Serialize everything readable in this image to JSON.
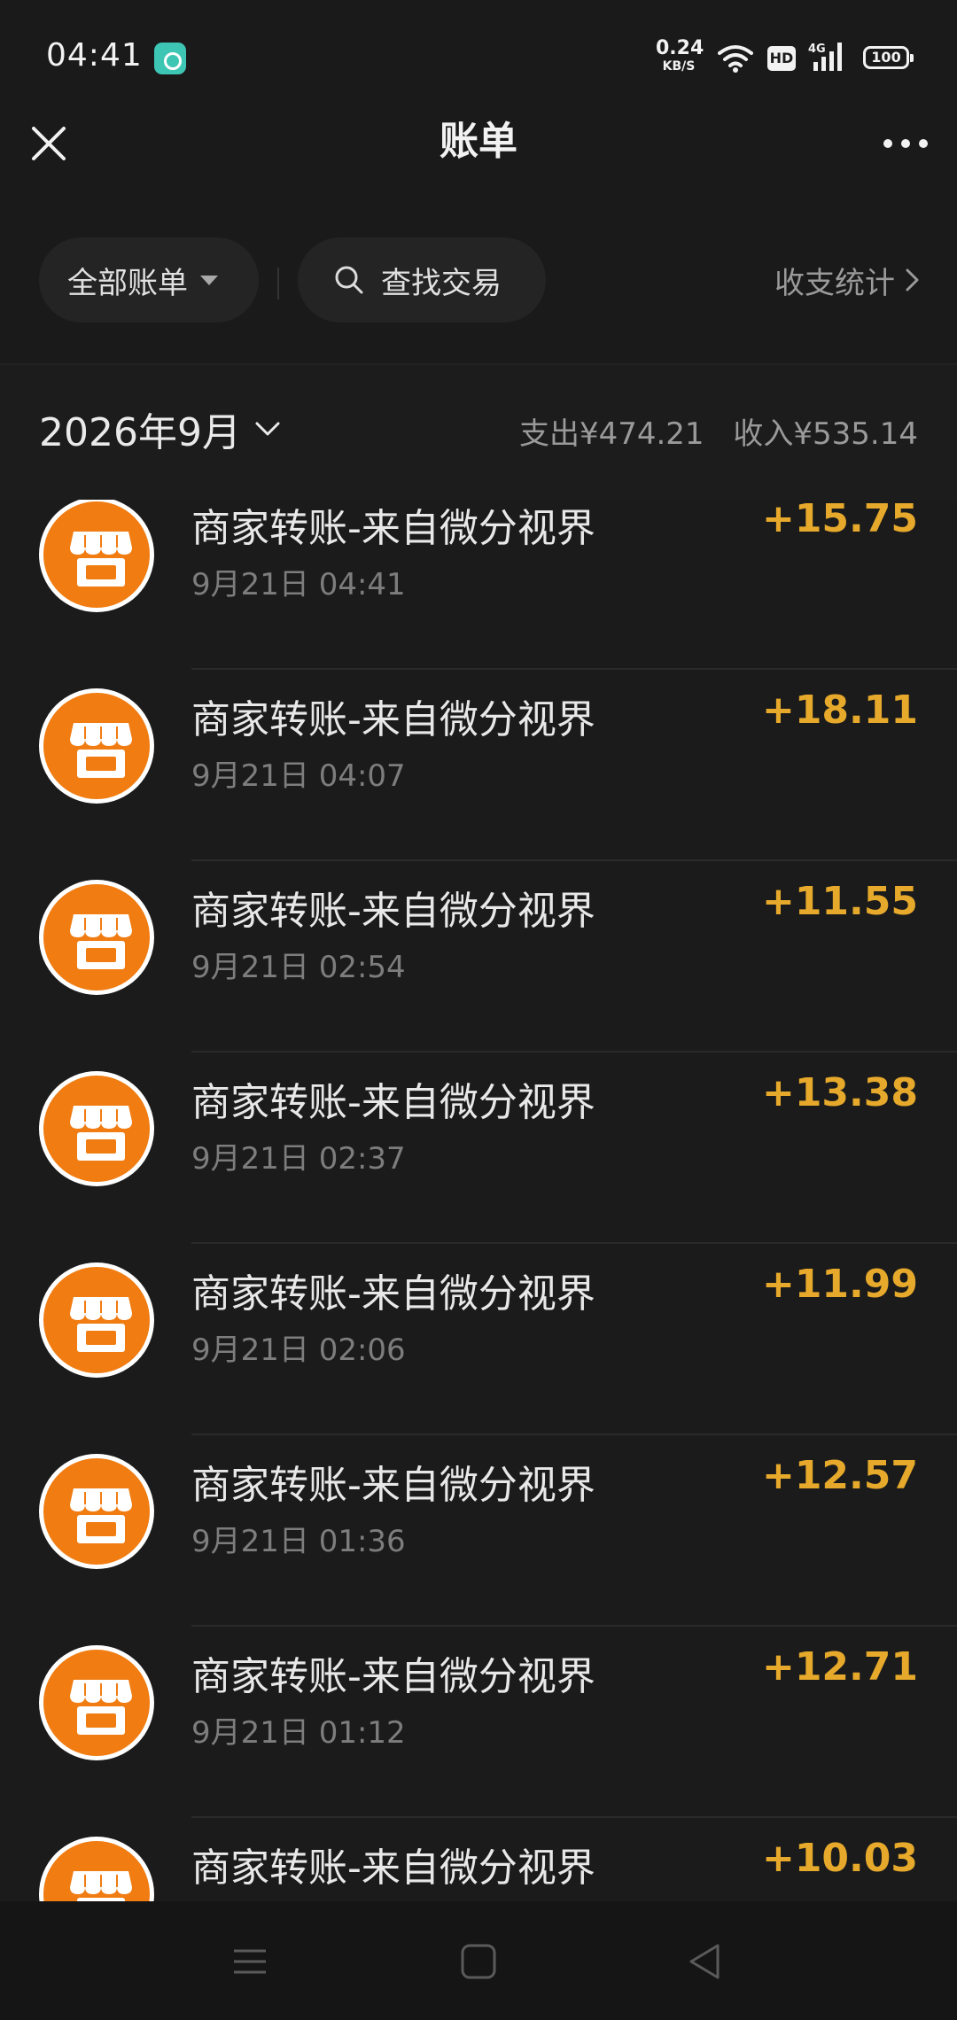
{
  "status_bar": {
    "time": "04:41",
    "net_speed_value": "0.24",
    "net_speed_unit": "KB/S",
    "hd_label": "HD",
    "signal_label": "4G",
    "battery": "100"
  },
  "header": {
    "title": "账单",
    "close_icon": "close-icon",
    "more_icon": "more-icon"
  },
  "filters": {
    "all_bills_label": "全部账单",
    "search_label": "查找交易",
    "stats_label": "收支统计"
  },
  "month": {
    "label": "2026年9月",
    "expense": "支出¥474.21",
    "income": "收入¥535.14"
  },
  "transactions": [
    {
      "title": "商家转账-来自微分视界",
      "time": "9月21日 04:41",
      "amount": "+15.75"
    },
    {
      "title": "商家转账-来自微分视界",
      "time": "9月21日 04:07",
      "amount": "+18.11"
    },
    {
      "title": "商家转账-来自微分视界",
      "time": "9月21日 02:54",
      "amount": "+11.55"
    },
    {
      "title": "商家转账-来自微分视界",
      "time": "9月21日 02:37",
      "amount": "+13.38"
    },
    {
      "title": "商家转账-来自微分视界",
      "time": "9月21日 02:06",
      "amount": "+11.99"
    },
    {
      "title": "商家转账-来自微分视界",
      "time": "9月21日 01:36",
      "amount": "+12.57"
    },
    {
      "title": "商家转账-来自微分视界",
      "time": "9月21日 01:12",
      "amount": "+12.71"
    },
    {
      "title": "商家转账-来自微分视界",
      "time": "",
      "amount": "+10.03"
    }
  ],
  "colors": {
    "background": "#1a1a1a",
    "amount": "#e6a92b",
    "merchant_icon": "#f07c12"
  }
}
